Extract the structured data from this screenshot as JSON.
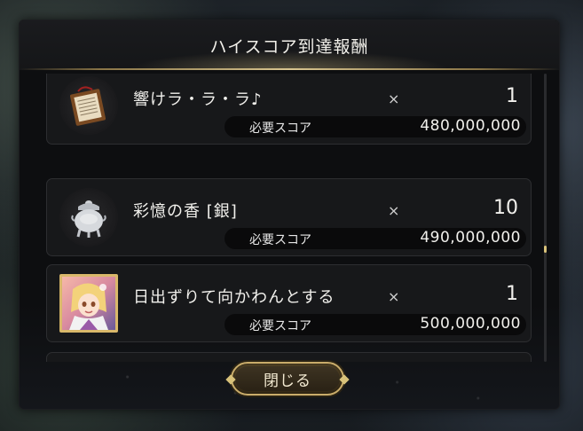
{
  "dialog": {
    "title": "ハイスコア到達報酬",
    "close_label": "閉じる"
  },
  "rewards": [
    {
      "name": "響けラ・ラ・ラ♪",
      "times": "×",
      "quantity": "1",
      "score_label": "必要スコア",
      "score": "480,000,000",
      "icon": "music-sheet-icon"
    },
    {
      "name": "彩憶の香 [銀]",
      "times": "×",
      "quantity": "10",
      "score_label": "必要スコア",
      "score": "490,000,000",
      "icon": "silver-incense-burner-icon"
    },
    {
      "name": "日出ずりて向かわんとする",
      "times": "×",
      "quantity": "1",
      "score_label": "必要スコア",
      "score": "500,000,000",
      "icon": "character-card-icon"
    }
  ],
  "colors": {
    "accent_gold": "#d8c27a",
    "panel": "#17181a",
    "dialog_bg": "#0d0e10"
  }
}
